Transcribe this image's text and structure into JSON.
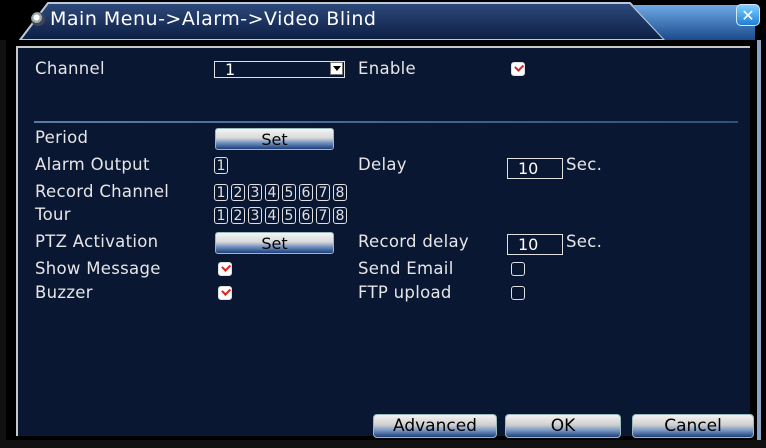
{
  "title": "Main Menu->Alarm->Video Blind",
  "close_label": "✕",
  "labels": {
    "channel": "Channel",
    "enable": "Enable",
    "period": "Period",
    "alarm_output": "Alarm Output",
    "delay": "Delay",
    "record_channel": "Record Channel",
    "tour": "Tour",
    "ptz_activation": "PTZ Activation",
    "record_delay": "Record delay",
    "show_message": "Show Message",
    "send_email": "Send Email",
    "buzzer": "Buzzer",
    "ftp_upload": "FTP upload",
    "sec": "Sec.",
    "sec2": "Sec."
  },
  "values": {
    "channel": "1",
    "delay": "10",
    "record_delay": "10",
    "alarm_output": "1",
    "enable_checked": true,
    "show_message_checked": true,
    "send_email_checked": false,
    "buzzer_checked": true,
    "ftp_upload_checked": false
  },
  "buttons": {
    "period_set": "Set",
    "ptz_set": "Set",
    "advanced": "Advanced",
    "ok": "OK",
    "cancel": "Cancel"
  },
  "channels": [
    "1",
    "2",
    "3",
    "4",
    "5",
    "6",
    "7",
    "8"
  ],
  "colors": {
    "background": "#000000",
    "panel": "#0a1733",
    "check_mark": "#e02020",
    "close_button": "#1e7fd6"
  }
}
